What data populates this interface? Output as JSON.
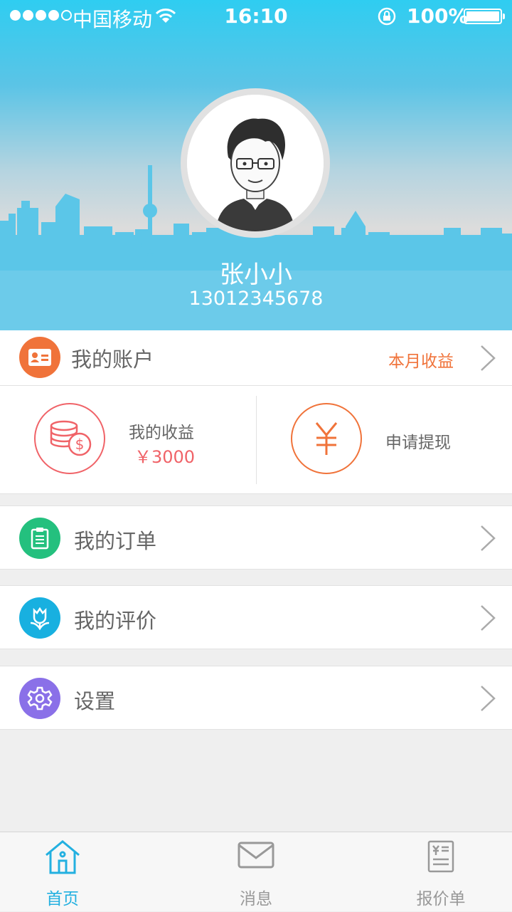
{
  "status_bar": {
    "carrier": "中国移动",
    "time": "16:10",
    "battery": "100%"
  },
  "profile": {
    "name": "张小小",
    "phone": "13012345678"
  },
  "account": {
    "label": "我的账户",
    "side_label": "本月收益"
  },
  "earnings": {
    "title": "我的收益",
    "amount": "￥3000",
    "withdraw_label": "申请提现",
    "withdraw_symbol": "￥"
  },
  "menu": {
    "orders": "我的订单",
    "reviews": "我的评价",
    "settings": "设置"
  },
  "tabs": [
    {
      "label": "首页",
      "icon": "home-icon",
      "active": true
    },
    {
      "label": "消息",
      "icon": "mail-icon",
      "active": false
    },
    {
      "label": "报价单",
      "icon": "quote-sheet-icon",
      "active": false
    }
  ],
  "colors": {
    "header_blue": "#5bc4e6",
    "account_orange": "#f0733a",
    "earnings_red": "#f06368",
    "orders_green": "#24c07e",
    "reviews_blue": "#18b0e0",
    "settings_purple": "#8a70e8",
    "tab_active": "#23b0e0"
  }
}
